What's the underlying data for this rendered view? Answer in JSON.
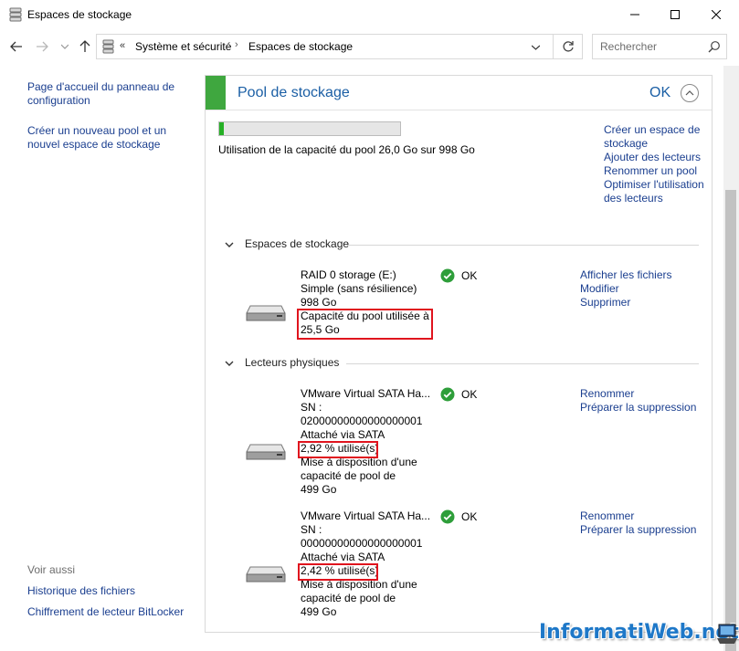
{
  "window": {
    "title": "Espaces de stockage"
  },
  "address_bar": {
    "overflow_label": "«",
    "crumbs": [
      "Système et sécurité",
      "Espaces de stockage"
    ],
    "separator": "›"
  },
  "search": {
    "placeholder": "Rechercher"
  },
  "left_nav": {
    "links": [
      "Page d'accueil du panneau de configuration",
      "Créer un nouveau pool et un nouvel espace de stockage"
    ],
    "see_also_label": "Voir aussi",
    "see_also": [
      "Historique des fichiers",
      "Chiffrement de lecteur BitLocker"
    ]
  },
  "pool": {
    "title": "Pool de stockage",
    "status": "OK",
    "usage_fraction": 0.026,
    "usage_text": "Utilisation de la capacité du pool 26,0 Go sur 998 Go",
    "actions": [
      "Créer un espace de stockage",
      "Ajouter des lecteurs",
      "Renommer un pool",
      "Optimiser l'utilisation des lecteurs"
    ]
  },
  "storage_spaces": {
    "label": "Espaces de stockage",
    "items": [
      {
        "name": "RAID 0 storage (E:)",
        "resilience": "Simple (sans résilience)",
        "size": "998 Go",
        "pool_usage_line1": "Capacité du pool utilisée à",
        "pool_usage_line2": "25,5 Go",
        "status": "OK",
        "actions": [
          "Afficher les fichiers",
          "Modifier",
          "Supprimer"
        ]
      }
    ]
  },
  "physical_drives": {
    "label": "Lecteurs physiques",
    "items": [
      {
        "name": "VMware Virtual SATA Ha...",
        "sn_label": "SN :",
        "sn": "02000000000000000001",
        "attach": "Attaché via SATA",
        "usage": "2,92 % utilisé(s)",
        "provision_line1": "Mise à disposition d'une",
        "provision_line2": "capacité de pool de",
        "provision_line3": "499 Go",
        "status": "OK",
        "actions": [
          "Renommer",
          "Préparer la suppression"
        ]
      },
      {
        "name": "VMware Virtual SATA Ha...",
        "sn_label": "SN :",
        "sn": "00000000000000000001",
        "attach": "Attaché via SATA",
        "usage": "2,42 % utilisé(s)",
        "provision_line1": "Mise à disposition d'une",
        "provision_line2": "capacité de pool de",
        "provision_line3": "499 Go",
        "status": "OK",
        "actions": [
          "Renommer",
          "Préparer la suppression"
        ]
      }
    ]
  },
  "watermark": "InformatiWeb.net",
  "colors": {
    "link": "#1a3e8f",
    "header_accent": "#3fa73f",
    "title_blue": "#1b5fa5",
    "ok_green": "#2e9e3a",
    "highlight_red": "#e0141e"
  }
}
